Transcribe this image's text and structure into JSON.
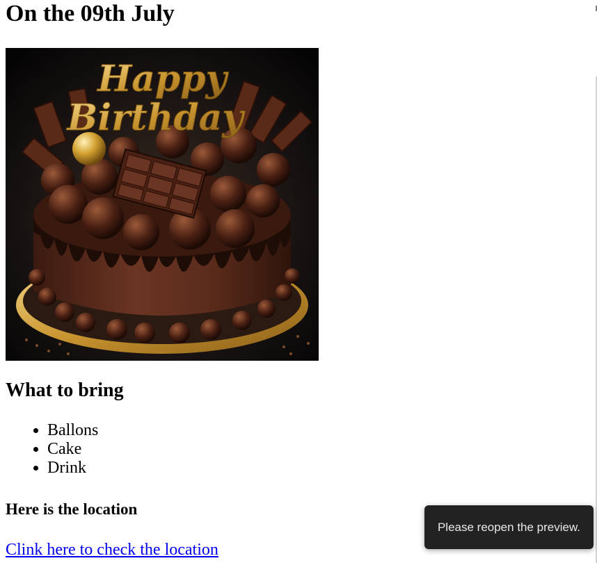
{
  "page": {
    "title": "On the 09th July",
    "image_alt": "Happy Birthday chocolate cake",
    "image_text": "Happy Birthday",
    "bring_heading": "What to bring",
    "bring_items": [
      "Ballons",
      "Cake",
      "Drink"
    ],
    "location_heading": "Here is the location",
    "location_link": "Clink here to check the location"
  },
  "toast": {
    "message": "Please reopen the preview."
  },
  "colors": {
    "link": "#0000ee",
    "toast_bg": "#222222",
    "toast_text": "#e8e8e8"
  }
}
